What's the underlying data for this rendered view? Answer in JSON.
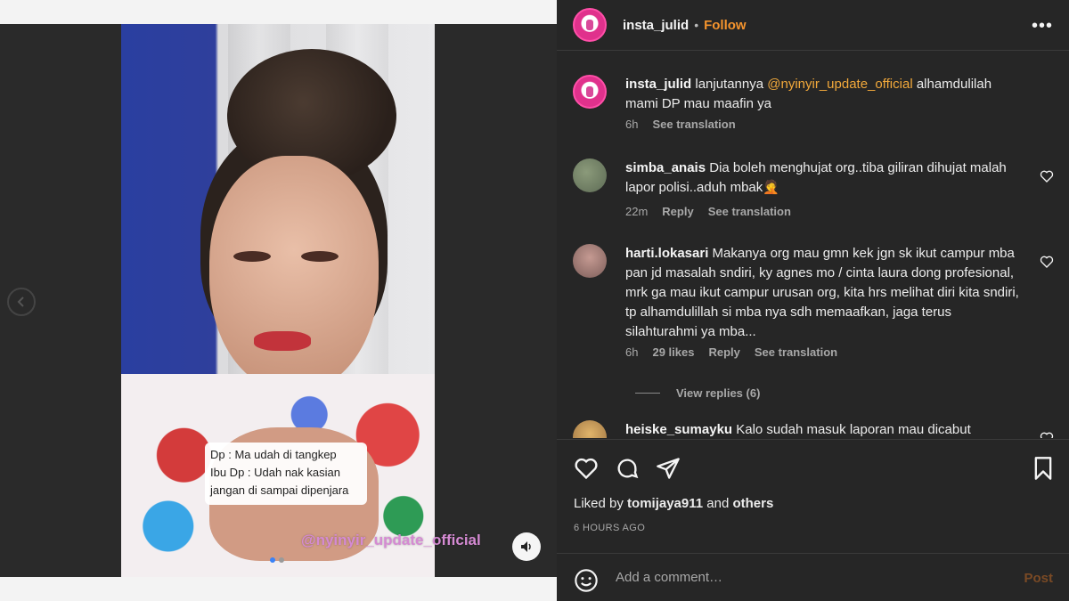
{
  "video": {
    "caption_lines": [
      "Dp : Ma udah di tangkep",
      "Ibu Dp : Udah nak kasian",
      "jangan di sampai dipenjara"
    ],
    "watermark": "@nyinyir_update_official"
  },
  "header": {
    "username": "insta_julid",
    "separator": "•",
    "follow_label": "Follow",
    "more_label": "•••"
  },
  "comments": [
    {
      "username": "insta_julid",
      "text_before": " lanjutannya ",
      "mention": "@nyinyir_update_official",
      "text_after": " alhamdulilah mami DP mau maafin ya",
      "time": "6h",
      "translation": "See translation"
    },
    {
      "username": "simba_anais",
      "text": " Dia boleh menghujat org..tiba giliran dihujat malah lapor polisi..aduh mbak🤦",
      "time": "22m",
      "reply": "Reply",
      "translation": "See translation"
    },
    {
      "username": "harti.lokasari",
      "text": " Makanya org mau gmn kek jgn sk ikut campur mba pan jd masalah sndiri, ky agnes mo / cinta laura dong profesional, mrk ga mau ikut campur urusan org, kita hrs melihat diri kita sndiri, tp alhamdulillah si mba nya sdh memaafkan, jaga terus silahturahmi ya mba...",
      "time": "6h",
      "likes": "29 likes",
      "reply": "Reply",
      "translation": "See translation",
      "view_replies": "View replies (6)"
    },
    {
      "username": "heiske_sumayku",
      "text": " Kalo sudah masuk laporan mau dicabut"
    }
  ],
  "actions": {
    "liked_prefix": "Liked by ",
    "liked_user": "tomijaya911",
    "liked_and": " and ",
    "liked_others": "others",
    "timestamp": "6 HOURS AGO"
  },
  "comment_input": {
    "placeholder": "Add a comment…",
    "post_label": "Post"
  },
  "colors": {
    "follow": "#f5942d",
    "mention": "#f2a93b",
    "panel_bg": "#262626"
  }
}
